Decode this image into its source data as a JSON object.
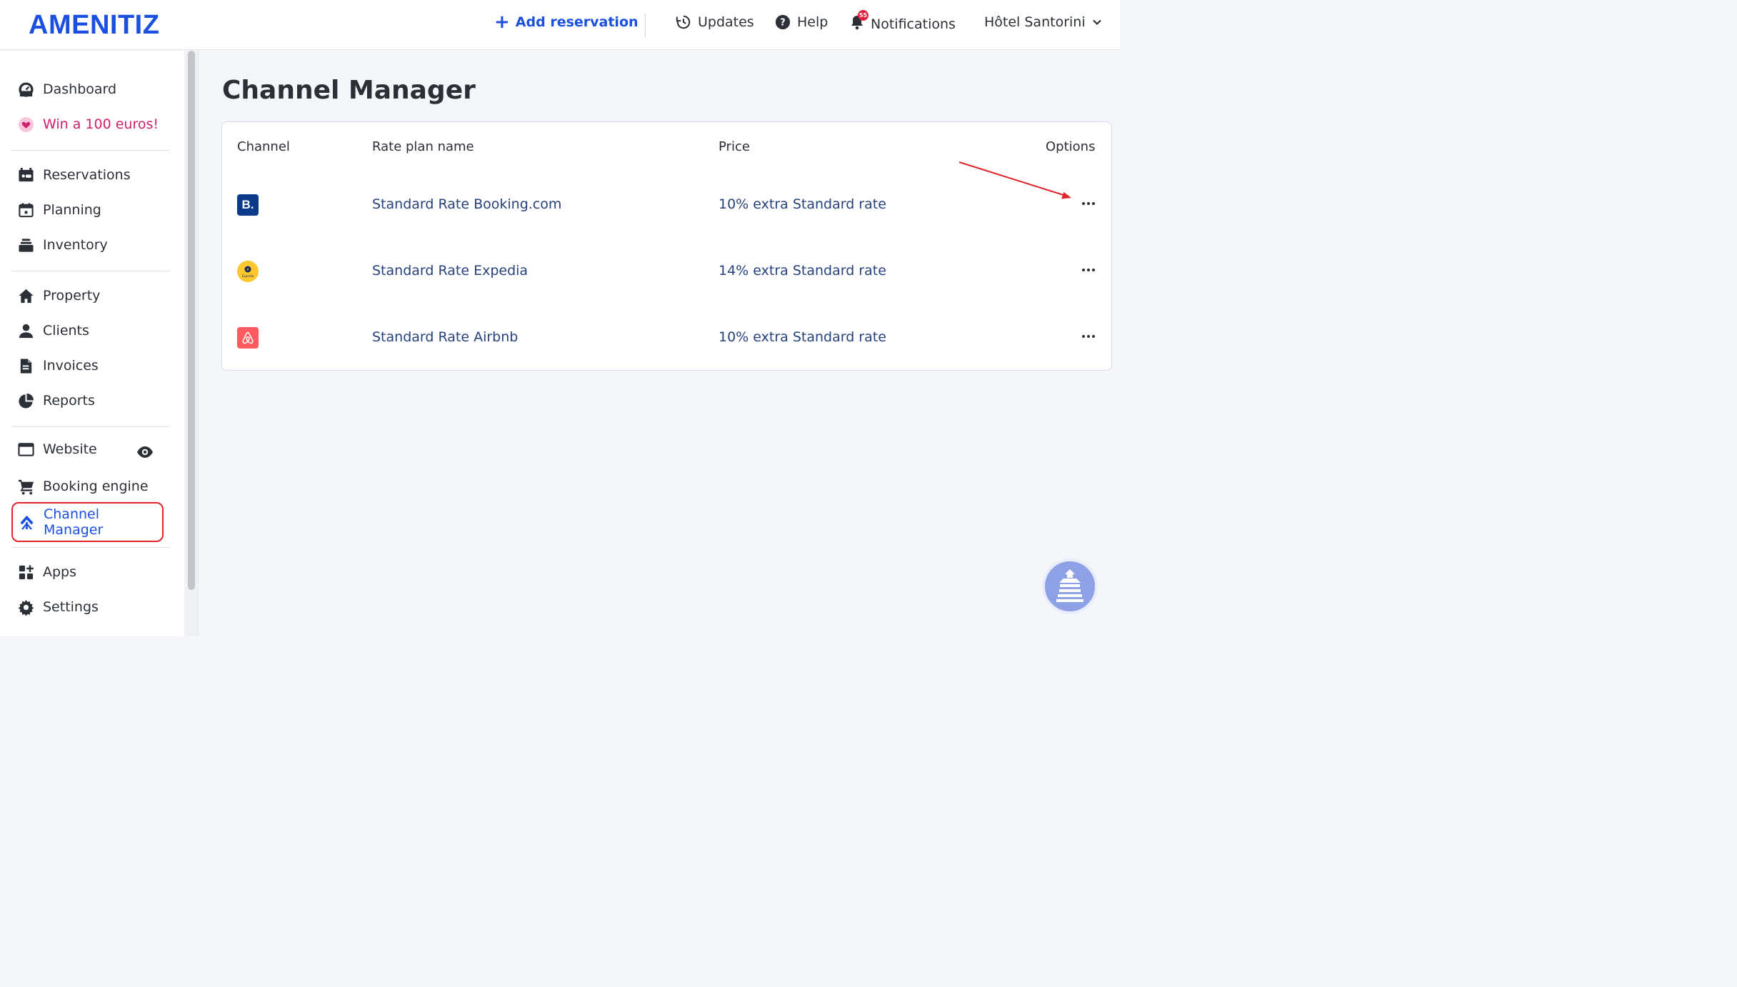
{
  "brand": {
    "name": "AMENITIZ",
    "accent": "#1a4fe0"
  },
  "header": {
    "add_reservation": "Add reservation",
    "updates": "Updates",
    "help": "Help",
    "notifications": "Notifications",
    "notification_count": "55",
    "hotel": "Hôtel Santorini"
  },
  "sidebar": {
    "items": [
      {
        "label": "Dashboard",
        "icon": "gauge-icon"
      },
      {
        "label": "Win a 100 euros!",
        "icon": "heart-icon"
      },
      {
        "label": "Reservations",
        "icon": "calendar-bed-icon"
      },
      {
        "label": "Planning",
        "icon": "calendar-icon"
      },
      {
        "label": "Inventory",
        "icon": "stack-icon"
      },
      {
        "label": "Property",
        "icon": "home-icon"
      },
      {
        "label": "Clients",
        "icon": "users-icon"
      },
      {
        "label": "Invoices",
        "icon": "file-icon"
      },
      {
        "label": "Reports",
        "icon": "pie-chart-icon"
      },
      {
        "label": "Website",
        "icon": "browser-icon"
      },
      {
        "label": "Booking engine",
        "icon": "cart-icon"
      },
      {
        "label": "Channel Manager",
        "icon": "channel-icon"
      },
      {
        "label": "Apps",
        "icon": "apps-icon"
      },
      {
        "label": "Settings",
        "icon": "gear-icon"
      }
    ]
  },
  "main": {
    "title": "Channel Manager",
    "columns": {
      "channel": "Channel",
      "rate_plan": "Rate plan name",
      "price": "Price",
      "options": "Options"
    },
    "rows": [
      {
        "channel": "Booking.com",
        "logo_text": "B.",
        "rate_plan": "Standard Rate Booking.com",
        "price": "10% extra Standard rate"
      },
      {
        "channel": "Expedia",
        "logo_text": "Expedia",
        "rate_plan": "Standard Rate Expedia",
        "price": "14% extra Standard rate"
      },
      {
        "channel": "Airbnb",
        "logo_text": "",
        "rate_plan": "Standard Rate Airbnb",
        "price": "10% extra Standard rate"
      }
    ]
  },
  "colors": {
    "link": "#27417a",
    "promo": "#d11f6b",
    "highlight": "#e0242c"
  }
}
